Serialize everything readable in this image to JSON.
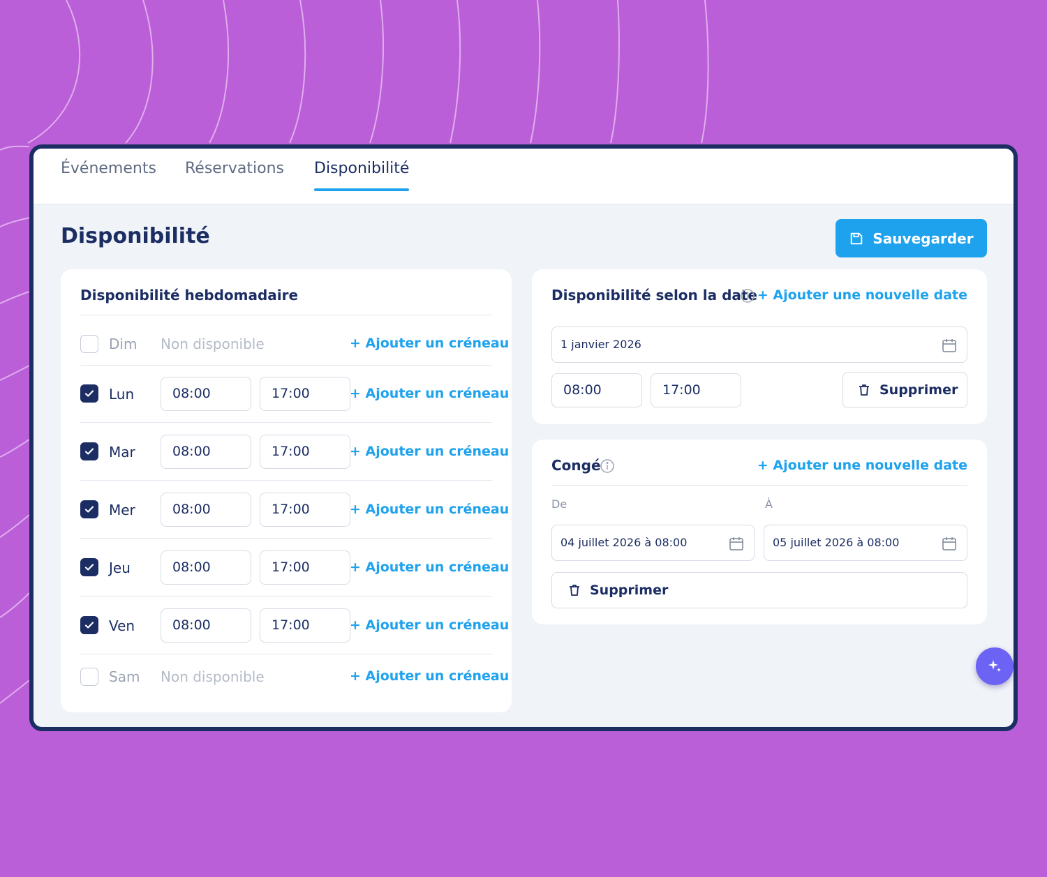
{
  "tabs": [
    {
      "label": "Événements"
    },
    {
      "label": "Réservations"
    },
    {
      "label": "Disponibilité",
      "active": true
    }
  ],
  "page": {
    "title": "Disponibilité",
    "save_label": "Sauvegarder"
  },
  "weekly": {
    "title": "Disponibilité hebdomadaire",
    "add_slot_label": "+ Ajouter un créneau",
    "unavailable_label": "Non disponible",
    "days": [
      {
        "label": "Dim",
        "enabled": false
      },
      {
        "label": "Lun",
        "enabled": true,
        "start": "08:00",
        "end": "17:00"
      },
      {
        "label": "Mar",
        "enabled": true,
        "start": "08:00",
        "end": "17:00"
      },
      {
        "label": "Mer",
        "enabled": true,
        "start": "08:00",
        "end": "17:00"
      },
      {
        "label": "Jeu",
        "enabled": true,
        "start": "08:00",
        "end": "17:00"
      },
      {
        "label": "Ven",
        "enabled": true,
        "start": "08:00",
        "end": "17:00"
      },
      {
        "label": "Sam",
        "enabled": false
      }
    ]
  },
  "date_override": {
    "title": "Disponibilité selon la date",
    "add_date_label": "+ Ajouter une nouvelle date",
    "date": "1 janvier 2026",
    "start": "08:00",
    "end": "17:00",
    "delete_label": "Supprimer"
  },
  "leave": {
    "title": "Congé",
    "add_date_label": "+ Ajouter une nouvelle date",
    "from_label": "De",
    "to_label": "À",
    "from_value": "04 juillet 2026 à 08:00",
    "to_value": "05 juillet 2026 à 08:00",
    "delete_label": "Supprimer"
  },
  "colors": {
    "background": "#bb5fd8",
    "primary": "#1ea2ee",
    "navy": "#1b2d63",
    "fab": "#6c63f5"
  }
}
